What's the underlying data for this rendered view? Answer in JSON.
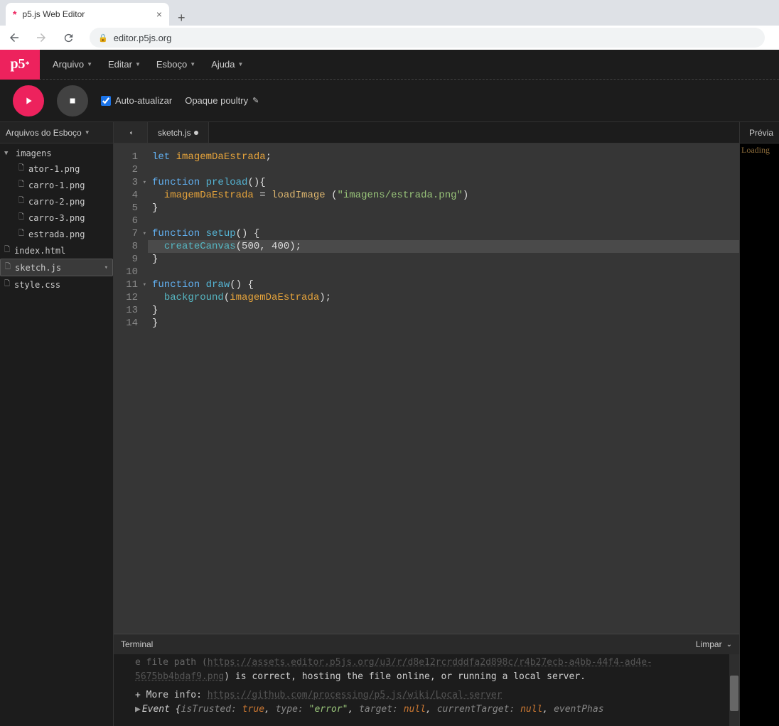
{
  "browser": {
    "tab_title": "p5.js Web Editor",
    "url": "editor.p5js.org"
  },
  "logo": "p5",
  "menus": [
    "Arquivo",
    "Editar",
    "Esboço",
    "Ajuda"
  ],
  "toolbar": {
    "auto_update_label": "Auto-atualizar",
    "auto_update_checked": true,
    "sketch_name": "Opaque poultry"
  },
  "sidebar": {
    "title": "Arquivos do Esboço",
    "folder": "imagens",
    "folder_files": [
      "ator-1.png",
      "carro-1.png",
      "carro-2.png",
      "carro-3.png",
      "estrada.png"
    ],
    "root_files": [
      "index.html",
      "sketch.js",
      "style.css"
    ],
    "selected": "sketch.js"
  },
  "editor": {
    "tab_name": "sketch.js",
    "modified": true,
    "highlighted_line": 8,
    "fold_lines": [
      3,
      7,
      11
    ],
    "lines": [
      [
        {
          "t": "let ",
          "c": "kw"
        },
        {
          "t": "imagemDaEstrada",
          "c": "var"
        },
        {
          "t": ";",
          "c": ""
        }
      ],
      [],
      [
        {
          "t": "function ",
          "c": "kw"
        },
        {
          "t": "preload",
          "c": "fn"
        },
        {
          "t": "(){",
          "c": ""
        }
      ],
      [
        {
          "t": "  imagemDaEstrada ",
          "c": "var"
        },
        {
          "t": "= ",
          "c": ""
        },
        {
          "t": "loadImage ",
          "c": "call"
        },
        {
          "t": "(",
          "c": ""
        },
        {
          "t": "\"imagens/estrada.png\"",
          "c": "str"
        },
        {
          "t": ")",
          "c": ""
        }
      ],
      [
        {
          "t": "}",
          "c": ""
        }
      ],
      [],
      [
        {
          "t": "function ",
          "c": "kw"
        },
        {
          "t": "setup",
          "c": "fn"
        },
        {
          "t": "() {",
          "c": ""
        }
      ],
      [
        {
          "t": "  ",
          "c": ""
        },
        {
          "t": "createCanvas",
          "c": "callb"
        },
        {
          "t": "(500, 400);",
          "c": ""
        }
      ],
      [
        {
          "t": "}",
          "c": ""
        }
      ],
      [],
      [
        {
          "t": "function ",
          "c": "kw"
        },
        {
          "t": "draw",
          "c": "fn"
        },
        {
          "t": "() {",
          "c": ""
        }
      ],
      [
        {
          "t": "  ",
          "c": ""
        },
        {
          "t": "background",
          "c": "callb"
        },
        {
          "t": "(",
          "c": ""
        },
        {
          "t": "imagemDaEstrada",
          "c": "var"
        },
        {
          "t": ");",
          "c": ""
        }
      ],
      [
        {
          "t": "}",
          "c": ""
        }
      ],
      [
        {
          "t": "}",
          "c": ""
        }
      ]
    ]
  },
  "preview": {
    "label": "Prévia",
    "status": "Loading"
  },
  "console": {
    "title": "Terminal",
    "clear_label": "Limpar",
    "line1_pre": "e file path (",
    "line1_link": "https://assets.editor.p5js.org/u3/r/d8e12rcrdddfa2d898c/r4b27ecb-a4bb-44f4-ad4e-5675bb4bdaf9.png",
    "line1_post": ") is correct, hosting the file online, or running a local server.",
    "line2_pre": "+ More info: ",
    "line2_link": "https://github.com/processing/p5.js/wiki/Local-server",
    "event_prefix": "▶",
    "event_label": "Event ",
    "event_open": "{",
    "event_k1": "isTrusted: ",
    "event_v1": "true",
    "event_k2": "type: ",
    "event_v2": "\"error\"",
    "event_k3": "target: ",
    "event_v3": "null",
    "event_k4": "currentTarget: ",
    "event_v4": "null",
    "event_k5": "eventPhas",
    "sep": ", "
  }
}
